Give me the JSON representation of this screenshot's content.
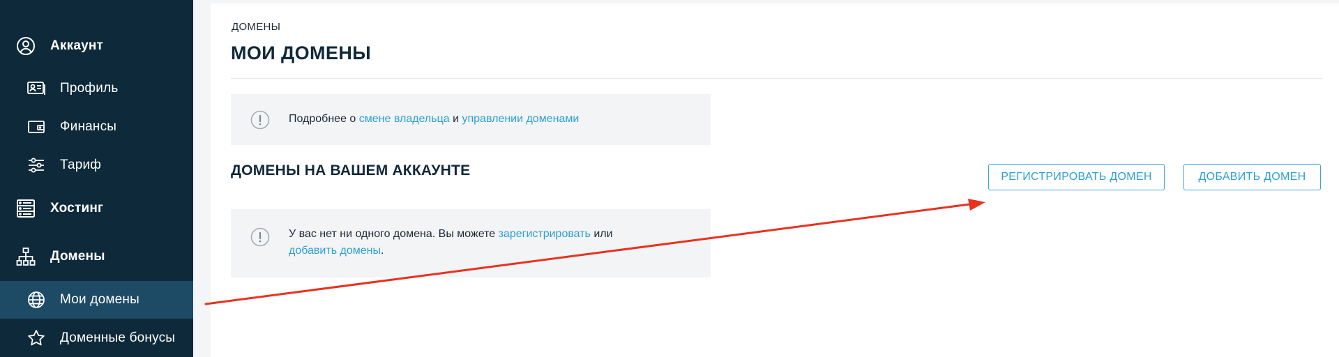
{
  "sidebar": {
    "items": [
      {
        "label": "Аккаунт",
        "icon": "user-circle-icon",
        "type": "section"
      },
      {
        "label": "Профиль",
        "icon": "id-card-icon",
        "type": "sub"
      },
      {
        "label": "Финансы",
        "icon": "wallet-icon",
        "type": "sub"
      },
      {
        "label": "Тариф",
        "icon": "sliders-icon",
        "type": "sub"
      },
      {
        "label": "Хостинг",
        "icon": "server-icon",
        "type": "section"
      },
      {
        "label": "Домены",
        "icon": "sitemap-icon",
        "type": "section"
      },
      {
        "label": "Мои домены",
        "icon": "globe-icon",
        "type": "sub",
        "active": true
      },
      {
        "label": "Доменные бонусы",
        "icon": "star-icon",
        "type": "sub"
      }
    ]
  },
  "main": {
    "breadcrumb": "ДОМЕНЫ",
    "title": "МОИ ДОМЕНЫ",
    "info_notice": {
      "prefix": "Подробнее о ",
      "link1": "смене владельца",
      "middle": " и ",
      "link2": "управлении доменами"
    },
    "section_title": "ДОМЕНЫ НА ВАШЕМ АККАУНТЕ",
    "register_button": "РЕГИСТРИРОВАТЬ ДОМЕН",
    "add_button": "ДОБАВИТЬ ДОМЕН",
    "empty_notice": {
      "prefix": "У вас нет ни одного домена. Вы можете ",
      "link1": "зарегистрировать",
      "middle": " или",
      "link2": "добавить домены",
      "suffix": "."
    }
  },
  "colors": {
    "sidebar_bg": "#0e2a3a",
    "sidebar_active": "#1d4b66",
    "accent": "#2a9fd6",
    "annotation_arrow": "#e8321e"
  }
}
